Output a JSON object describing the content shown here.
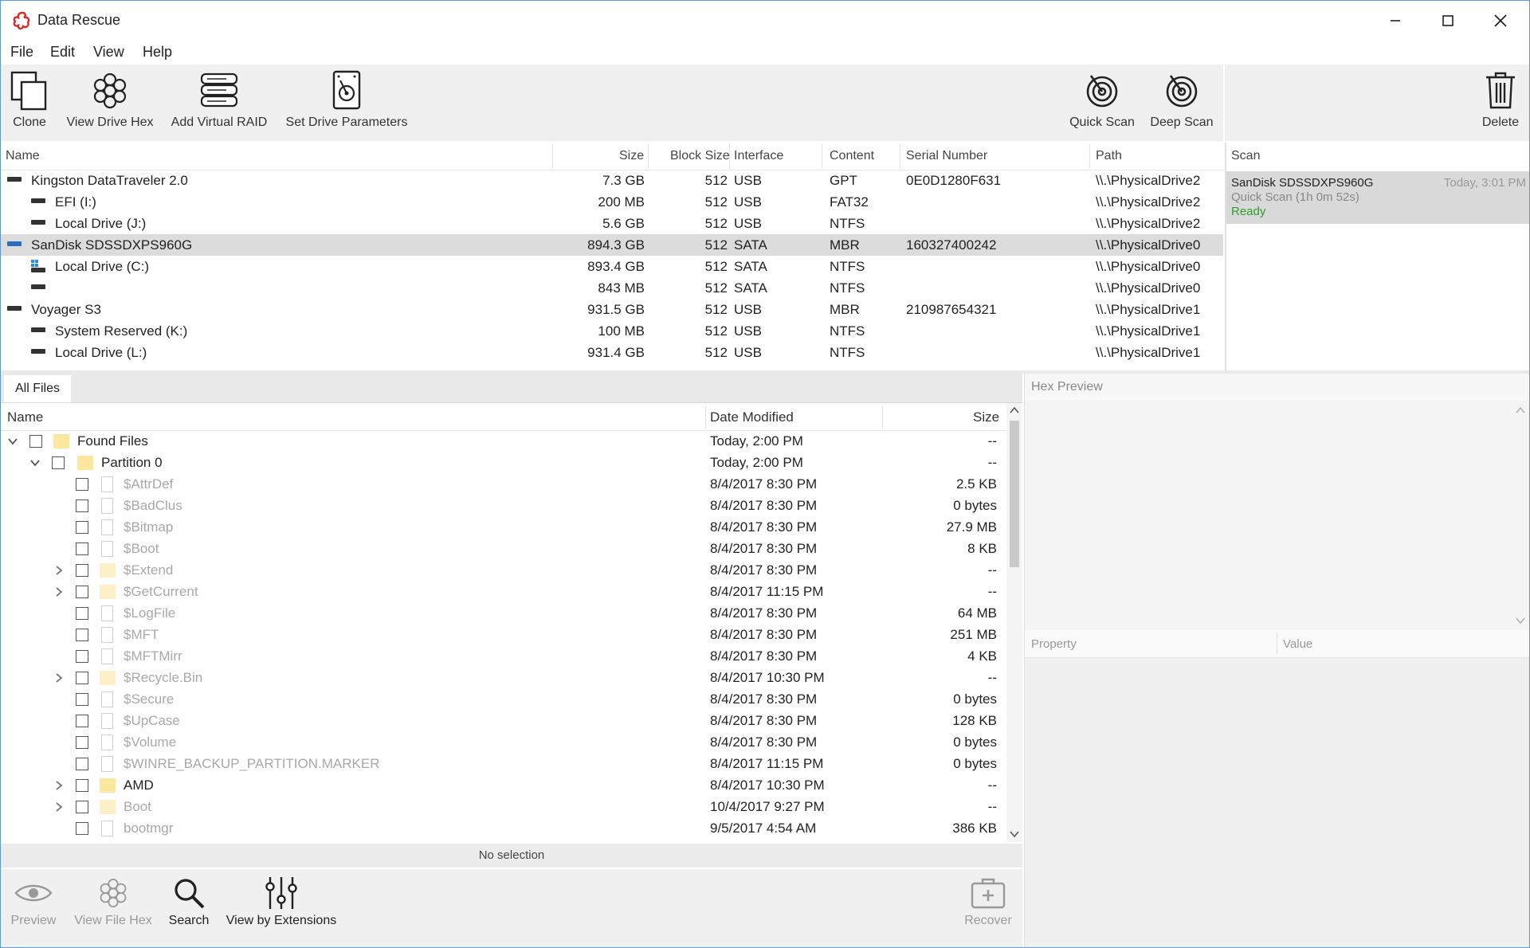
{
  "app": {
    "title": "Data Rescue"
  },
  "menu": [
    "File",
    "Edit",
    "View",
    "Help"
  ],
  "toolbar": {
    "clone": "Clone",
    "view_drive_hex": "View Drive Hex",
    "add_virtual_raid": "Add Virtual RAID",
    "set_drive_parameters": "Set Drive Parameters",
    "quick_scan": "Quick Scan",
    "deep_scan": "Deep Scan",
    "delete": "Delete"
  },
  "drives": {
    "columns": {
      "name": "Name",
      "size": "Size",
      "block_size": "Block Size",
      "interface": "Interface",
      "content": "Content",
      "serial": "Serial Number",
      "path": "Path"
    },
    "rows": [
      {
        "name": "Kingston DataTraveler 2.0",
        "size": "7.3 GB",
        "block": "512",
        "iface": "USB",
        "content": "GPT",
        "serial": "0E0D1280F631",
        "path": "\\\\.\\PhysicalDrive2"
      },
      {
        "name": "EFI (I:)",
        "size": "200 MB",
        "block": "512",
        "iface": "USB",
        "content": "FAT32",
        "serial": "",
        "path": "\\\\.\\PhysicalDrive2"
      },
      {
        "name": "Local Drive (J:)",
        "size": "5.6 GB",
        "block": "512",
        "iface": "USB",
        "content": "NTFS",
        "serial": "",
        "path": "\\\\.\\PhysicalDrive2"
      },
      {
        "name": "SanDisk SDSSDXPS960G",
        "size": "894.3 GB",
        "block": "512",
        "iface": "SATA",
        "content": "MBR",
        "serial": "160327400242",
        "path": "\\\\.\\PhysicalDrive0"
      },
      {
        "name": "Local Drive (C:)",
        "size": "893.4 GB",
        "block": "512",
        "iface": "SATA",
        "content": "NTFS",
        "serial": "",
        "path": "\\\\.\\PhysicalDrive0"
      },
      {
        "name": "",
        "size": "843 MB",
        "block": "512",
        "iface": "SATA",
        "content": "NTFS",
        "serial": "",
        "path": "\\\\.\\PhysicalDrive0"
      },
      {
        "name": "Voyager S3",
        "size": "931.5 GB",
        "block": "512",
        "iface": "USB",
        "content": "MBR",
        "serial": "210987654321",
        "path": "\\\\.\\PhysicalDrive1"
      },
      {
        "name": "System Reserved (K:)",
        "size": "100 MB",
        "block": "512",
        "iface": "USB",
        "content": "NTFS",
        "serial": "",
        "path": "\\\\.\\PhysicalDrive1"
      },
      {
        "name": "Local Drive (L:)",
        "size": "931.4 GB",
        "block": "512",
        "iface": "USB",
        "content": "NTFS",
        "serial": "",
        "path": "\\\\.\\PhysicalDrive1"
      }
    ]
  },
  "scan": {
    "header": "Scan",
    "item": {
      "drive": "SanDisk SDSSDXPS960G",
      "time": "Today, 3:01 PM",
      "detail": "Quick Scan (1h 0m 52s)",
      "status": "Ready"
    }
  },
  "files": {
    "tab": "All Files",
    "columns": {
      "name": "Name",
      "date": "Date Modified",
      "size": "Size"
    },
    "rows": [
      {
        "name": "Found Files",
        "date": "Today, 2:00 PM",
        "size": "--"
      },
      {
        "name": "Partition 0",
        "date": "Today, 2:00 PM",
        "size": "--"
      },
      {
        "name": "$AttrDef",
        "date": "8/4/2017 8:30 PM",
        "size": "2.5 KB"
      },
      {
        "name": "$BadClus",
        "date": "8/4/2017 8:30 PM",
        "size": "0 bytes"
      },
      {
        "name": "$Bitmap",
        "date": "8/4/2017 8:30 PM",
        "size": "27.9 MB"
      },
      {
        "name": "$Boot",
        "date": "8/4/2017 8:30 PM",
        "size": "8 KB"
      },
      {
        "name": "$Extend",
        "date": "8/4/2017 8:30 PM",
        "size": "--"
      },
      {
        "name": "$GetCurrent",
        "date": "8/4/2017 11:15 PM",
        "size": "--"
      },
      {
        "name": "$LogFile",
        "date": "8/4/2017 8:30 PM",
        "size": "64 MB"
      },
      {
        "name": "$MFT",
        "date": "8/4/2017 8:30 PM",
        "size": "251 MB"
      },
      {
        "name": "$MFTMirr",
        "date": "8/4/2017 8:30 PM",
        "size": "4 KB"
      },
      {
        "name": "$Recycle.Bin",
        "date": "8/4/2017 10:30 PM",
        "size": "--"
      },
      {
        "name": "$Secure",
        "date": "8/4/2017 8:30 PM",
        "size": "0 bytes"
      },
      {
        "name": "$UpCase",
        "date": "8/4/2017 8:30 PM",
        "size": "128 KB"
      },
      {
        "name": "$Volume",
        "date": "8/4/2017 8:30 PM",
        "size": "0 bytes"
      },
      {
        "name": "$WINRE_BACKUP_PARTITION.MARKER",
        "date": "8/4/2017 11:15 PM",
        "size": "0 bytes"
      },
      {
        "name": "AMD",
        "date": "8/4/2017 10:30 PM",
        "size": "--"
      },
      {
        "name": "Boot",
        "date": "10/4/2017 9:27 PM",
        "size": "--"
      },
      {
        "name": "bootmgr",
        "date": "9/5/2017 4:54 AM",
        "size": "386 KB"
      }
    ]
  },
  "status": {
    "selection": "No selection"
  },
  "hex": {
    "header": "Hex Preview"
  },
  "properties": {
    "property": "Property",
    "value": "Value"
  },
  "bottom_toolbar": {
    "preview": "Preview",
    "view_file_hex": "View File Hex",
    "search": "Search",
    "view_by_extensions": "View by Extensions",
    "recover": "Recover"
  },
  "colors": {
    "ready": "#2e9d2e",
    "selected_row": "#dcdcdc",
    "folder": "#fce79e"
  }
}
